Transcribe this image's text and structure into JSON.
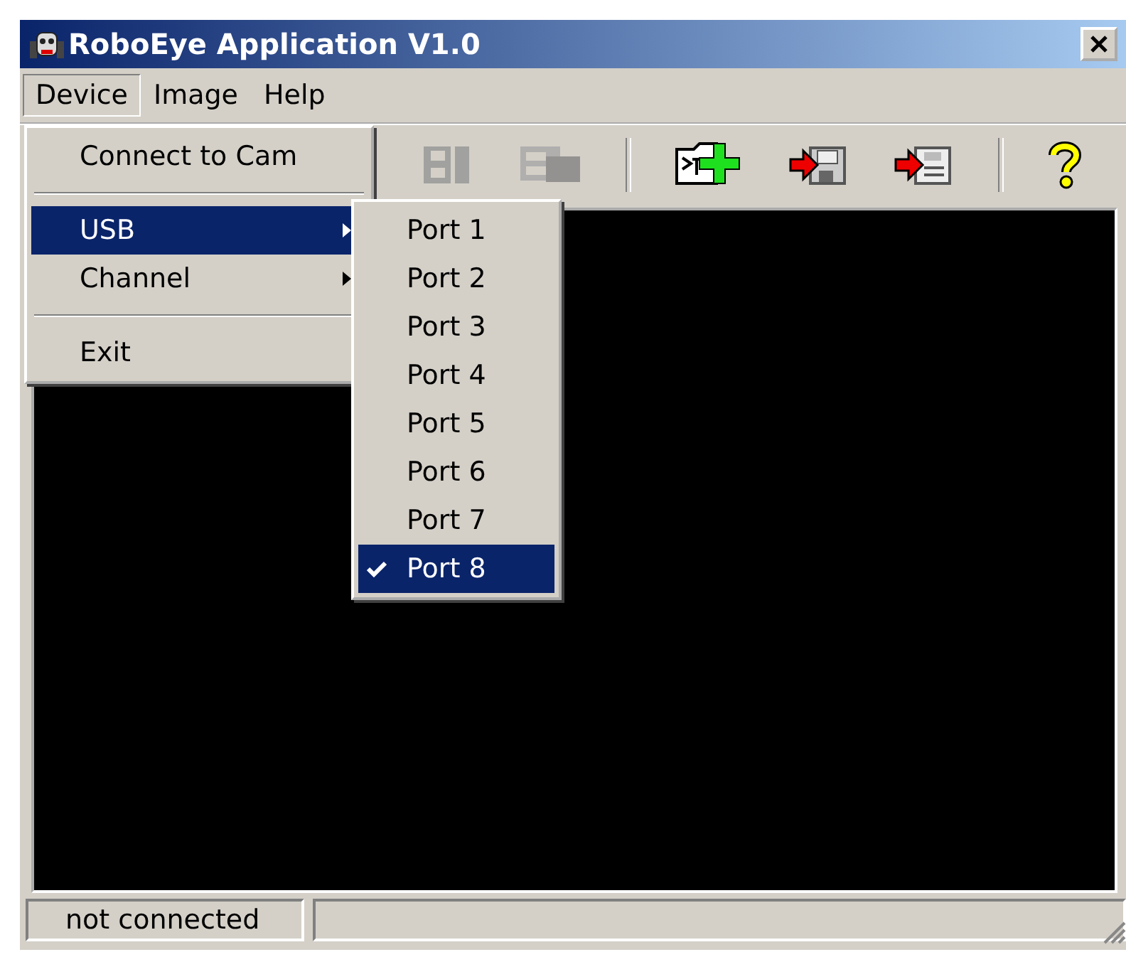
{
  "window": {
    "title": "RoboEye Application V1.0"
  },
  "menubar": [
    {
      "label": "Device",
      "selected": true
    },
    {
      "label": "Image",
      "selected": false
    },
    {
      "label": "Help",
      "selected": false
    }
  ],
  "device_menu": [
    {
      "kind": "item",
      "label": "Connect to Cam",
      "selected": false
    },
    {
      "kind": "separator"
    },
    {
      "kind": "submenu",
      "label": "USB",
      "selected": true
    },
    {
      "kind": "submenu",
      "label": "Channel",
      "selected": false
    },
    {
      "kind": "separator"
    },
    {
      "kind": "item",
      "label": "Exit",
      "selected": false
    }
  ],
  "usb_submenu": [
    {
      "label": "Port 1",
      "checked": false,
      "selected": false
    },
    {
      "label": "Port 2",
      "checked": false,
      "selected": false
    },
    {
      "label": "Port 3",
      "checked": false,
      "selected": false
    },
    {
      "label": "Port 4",
      "checked": false,
      "selected": false
    },
    {
      "label": "Port 5",
      "checked": false,
      "selected": false
    },
    {
      "label": "Port 6",
      "checked": false,
      "selected": false
    },
    {
      "label": "Port 7",
      "checked": false,
      "selected": false
    },
    {
      "label": "Port 8",
      "checked": true,
      "selected": true
    }
  ],
  "toolbar": [
    {
      "kind": "film",
      "disabled": true
    },
    {
      "kind": "film-camera",
      "disabled": true
    },
    {
      "kind": "separator"
    },
    {
      "kind": "script-add",
      "disabled": false
    },
    {
      "kind": "save-floppy",
      "disabled": false
    },
    {
      "kind": "save-doc",
      "disabled": false
    },
    {
      "kind": "separator"
    },
    {
      "kind": "help",
      "disabled": false
    }
  ],
  "status_bar": {
    "text": "not connected"
  }
}
